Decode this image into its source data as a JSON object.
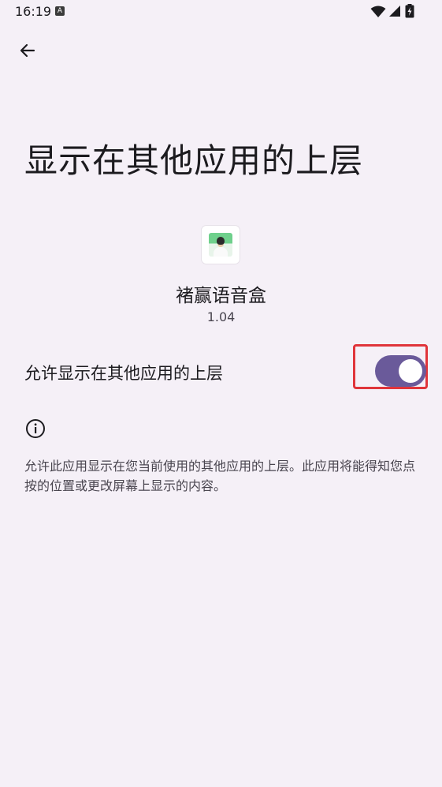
{
  "status_bar": {
    "time": "16:19",
    "app_indicator": "A",
    "icons": [
      "wifi-icon",
      "signal-icon",
      "battery-icon"
    ]
  },
  "navigation": {
    "back_icon": "arrow-left-icon"
  },
  "page": {
    "title": "显示在其他应用的上层"
  },
  "app": {
    "name": "褚赢语音盒",
    "version": "1.04"
  },
  "permission": {
    "label": "允许显示在其他应用的上层",
    "enabled": true
  },
  "info": {
    "icon": "info-icon",
    "description": "允许此应用显示在您当前使用的其他应用的上层。此应用将能得知您点按的位置或更改屏幕上显示的内容。"
  },
  "colors": {
    "background": "#f5f0f7",
    "toggle_on": "#6a5a9a",
    "highlight": "#e0353b"
  }
}
